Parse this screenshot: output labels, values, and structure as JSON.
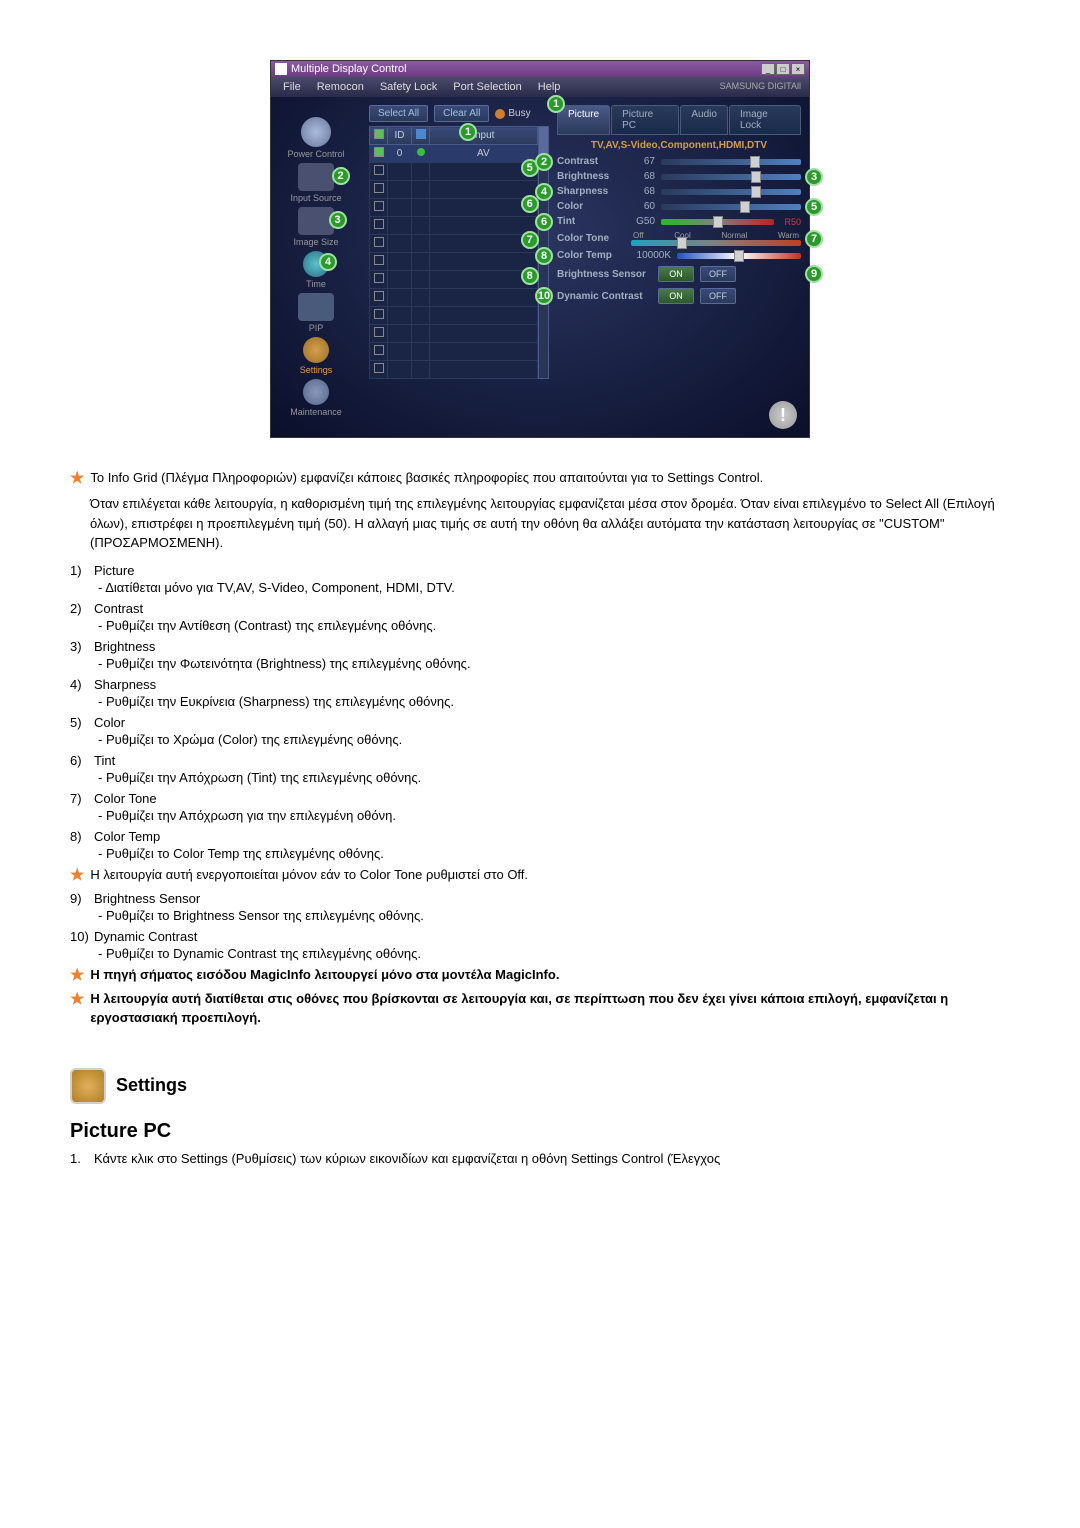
{
  "app": {
    "title": "Multiple Display Control",
    "menu": [
      "File",
      "Remocon",
      "Safety Lock",
      "Port Selection",
      "Help"
    ],
    "brand": "SAMSUNG DIGITAll"
  },
  "sidebar": {
    "items": [
      {
        "label": "Power Control"
      },
      {
        "label": "Input Source"
      },
      {
        "label": "Image Size"
      },
      {
        "label": "Time"
      },
      {
        "label": "PIP"
      },
      {
        "label": "Settings"
      },
      {
        "label": "Maintenance"
      }
    ]
  },
  "sidebar_badges": [
    "2",
    "3",
    "4"
  ],
  "grid": {
    "select_all": "Select All",
    "clear_all": "Clear All",
    "busy": "Busy",
    "headers": [
      "",
      "ID",
      "",
      "Input"
    ],
    "rows": [
      {
        "chk": true,
        "id": "0",
        "dot": "green",
        "input": "AV"
      },
      {
        "chk": false,
        "id": "",
        "dot": "",
        "input": ""
      },
      {
        "chk": false,
        "id": "",
        "dot": "",
        "input": ""
      }
    ]
  },
  "grid_badges": [
    "1",
    "5",
    "6",
    "7",
    "8"
  ],
  "tabs": [
    "Picture",
    "Picture PC",
    "Audio",
    "Image Lock"
  ],
  "panel_header": "TV,AV,S-Video,Component,HDMI,DTV",
  "sliders": [
    {
      "label": "Contrast",
      "value": "67",
      "badge_l": "2",
      "badge_r": ""
    },
    {
      "label": "Brightness",
      "value": "68",
      "badge_l": "",
      "badge_r": "3"
    },
    {
      "label": "Sharpness",
      "value": "68",
      "badge_l": "4",
      "badge_r": ""
    },
    {
      "label": "Color",
      "value": "60",
      "badge_l": "",
      "badge_r": "5"
    },
    {
      "label": "Tint",
      "value": "G50",
      "badge_l": "6",
      "badge_r": "",
      "end": "R50"
    }
  ],
  "color_tone": {
    "label": "Color Tone",
    "options": [
      "Off",
      "Cool",
      "Normal",
      "Warm"
    ],
    "badge": "7"
  },
  "color_temp": {
    "label": "Color Temp",
    "value": "10000K",
    "badge": "8"
  },
  "toggles": [
    {
      "label": "Brightness Sensor",
      "on": "ON",
      "off": "OFF",
      "badge": "9"
    },
    {
      "label": "Dynamic Contrast",
      "on": "ON",
      "off": "OFF",
      "badge": "10"
    }
  ],
  "right_top_badge": "1",
  "doc": {
    "intro": "Το Info Grid (Πλέγμα Πληροφοριών) εμφανίζει κάποιες βασικές πληροφορίες που απαιτούνται για το Settings Control.",
    "para2": "Όταν επιλέγεται κάθε λειτουργία, η καθορισμένη τιμή της επιλεγμένης λειτουργίας εμφανίζεται μέσα στον δρομέα. Όταν είναι επιλεγμένο το Select All (Επιλογή όλων), επιστρέφει η προεπιλεγμένη τιμή (50). Η αλλαγή μιας τιμής σε αυτή την οθόνη θα αλλάξει αυτόματα την κατάσταση λειτουργίας σε \"CUSTOM\" (ΠΡΟΣΑΡΜΟΣΜΕΝΗ).",
    "items": [
      {
        "n": "1)",
        "t": "Picture",
        "d": "- Διατίθεται μόνο για TV,AV, S-Video, Component, HDMI, DTV."
      },
      {
        "n": "2)",
        "t": "Contrast",
        "d": "- Ρυθμίζει την Αντίθεση (Contrast) της επιλεγμένης οθόνης."
      },
      {
        "n": "3)",
        "t": "Brightness",
        "d": "- Ρυθμίζει την Φωτεινότητα (Brightness) της επιλεγμένης οθόνης."
      },
      {
        "n": "4)",
        "t": "Sharpness",
        "d": "- Ρυθμίζει την Ευκρίνεια (Sharpness) της επιλεγμένης οθόνης."
      },
      {
        "n": "5)",
        "t": "Color",
        "d": "- Ρυθμίζει το Χρώμα (Color) της επιλεγμένης οθόνης."
      },
      {
        "n": "6)",
        "t": "Tint",
        "d": "- Ρυθμίζει την Απόχρωση (Tint) της επιλεγμένης οθόνης."
      },
      {
        "n": "7)",
        "t": "Color Tone",
        "d": "- Ρυθμίζει την Απόχρωση για την επιλεγμένη οθόνη."
      },
      {
        "n": "8)",
        "t": "Color Temp",
        "d": "- Ρυθμίζει το Color Temp της επιλεγμένης οθόνης."
      }
    ],
    "star_note": "Η λειτουργία αυτή ενεργοποιείται μόνον εάν το Color Tone ρυθμιστεί στο Off.",
    "items2": [
      {
        "n": "9)",
        "t": "Brightness Sensor",
        "d": "- Ρυθμίζει το Brightness Sensor της επιλεγμένης οθόνης."
      },
      {
        "n": "10)",
        "t": "Dynamic Contrast",
        "d": "- Ρυθμίζει το Dynamic Contrast της επιλεγμένης οθόνης."
      }
    ],
    "bold_notes": [
      "Η πηγή σήματος εισόδου MagicInfo λειτουργεί μόνο στα μοντέλα MagicInfo.",
      "Η λειτουργία αυτή διατίθεται στις οθόνες που βρίσκονται σε λειτουργία και, σε περίπτωση που δεν έχει γίνει κάποια επιλογή, εμφανίζεται η εργοστασιακή προεπιλογή."
    ],
    "section_title": "Settings",
    "sub_heading": "Picture PC",
    "ol1_n": "1.",
    "ol1_t": "Κάντε κλικ στο Settings (Ρυθμίσεις) των κύριων εικονιδίων και εμφανίζεται η οθόνη Settings Control (Έλεγχος"
  }
}
